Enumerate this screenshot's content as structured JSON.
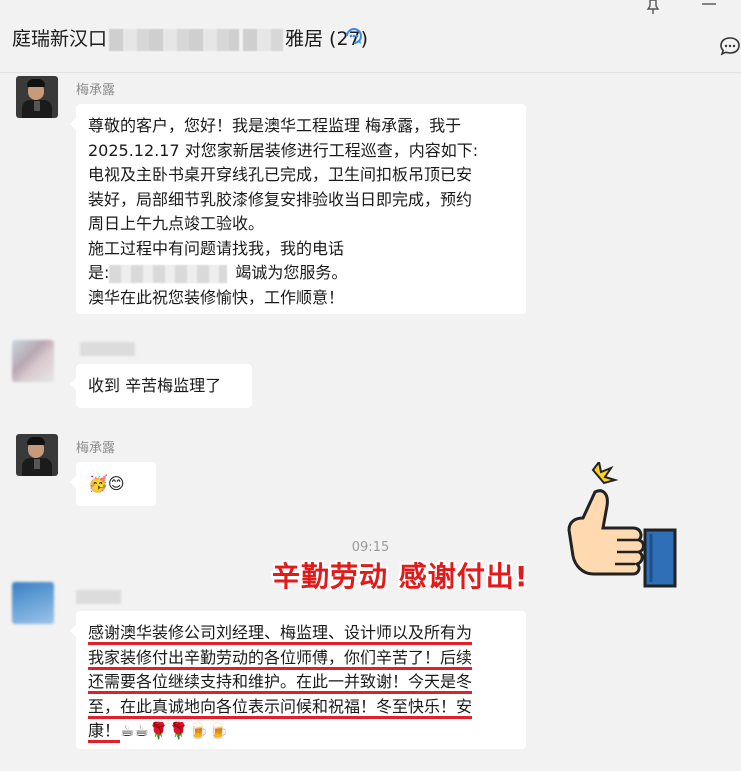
{
  "header": {
    "title_prefix": "庭瑞新汉口",
    "title_suffix": "雅居 (27)"
  },
  "messages": [
    {
      "sender": "梅承露",
      "lines": [
        "尊敬的客户，您好！我是澳华工程监理 梅承露，我于",
        "2025.12.17 对您家新居装修进行工程巡查，内容如下:",
        "电视及主卧书桌开穿线孔已完成，卫生间扣板吊顶已安",
        "装好，局部细节乳胶漆修复安排验收当日即完成，预约",
        "周日上午九点竣工验收。",
        "施工过程中有问题请找我，我的电话",
        "是:",
        "澳华在此祝您装修愉快，工作顺意！"
      ],
      "phone_suffix": "竭诚为您服务。"
    },
    {
      "sender": "",
      "text": "收到 辛苦梅监理了"
    },
    {
      "sender": "梅承露",
      "emojis": "🥳😊"
    },
    {
      "sender": "",
      "lines": [
        "感谢澳华装修公司刘经理、梅监理、设计师以及所有为",
        "我家装修付出辛勤劳动的各位师傅，你们辛苦了！后续",
        "还需要各位继续支持和维护。在此一并致谢！今天是冬",
        "至，在此真诚地向各位表示问候和祝福！冬至快乐！安",
        "康！"
      ],
      "emojis": "☕☕🌹🌹🍺🍺"
    }
  ],
  "time": "09:15",
  "overlay_caption": "辛勤劳动 感谢付出!",
  "colors": {
    "accent": "#e21a1a",
    "bubble": "#ffffff",
    "background": "#f2f2f2"
  },
  "icons": [
    "pin-icon",
    "more-icon",
    "refresh-icon",
    "chat-icon",
    "thumbs-up-icon"
  ]
}
